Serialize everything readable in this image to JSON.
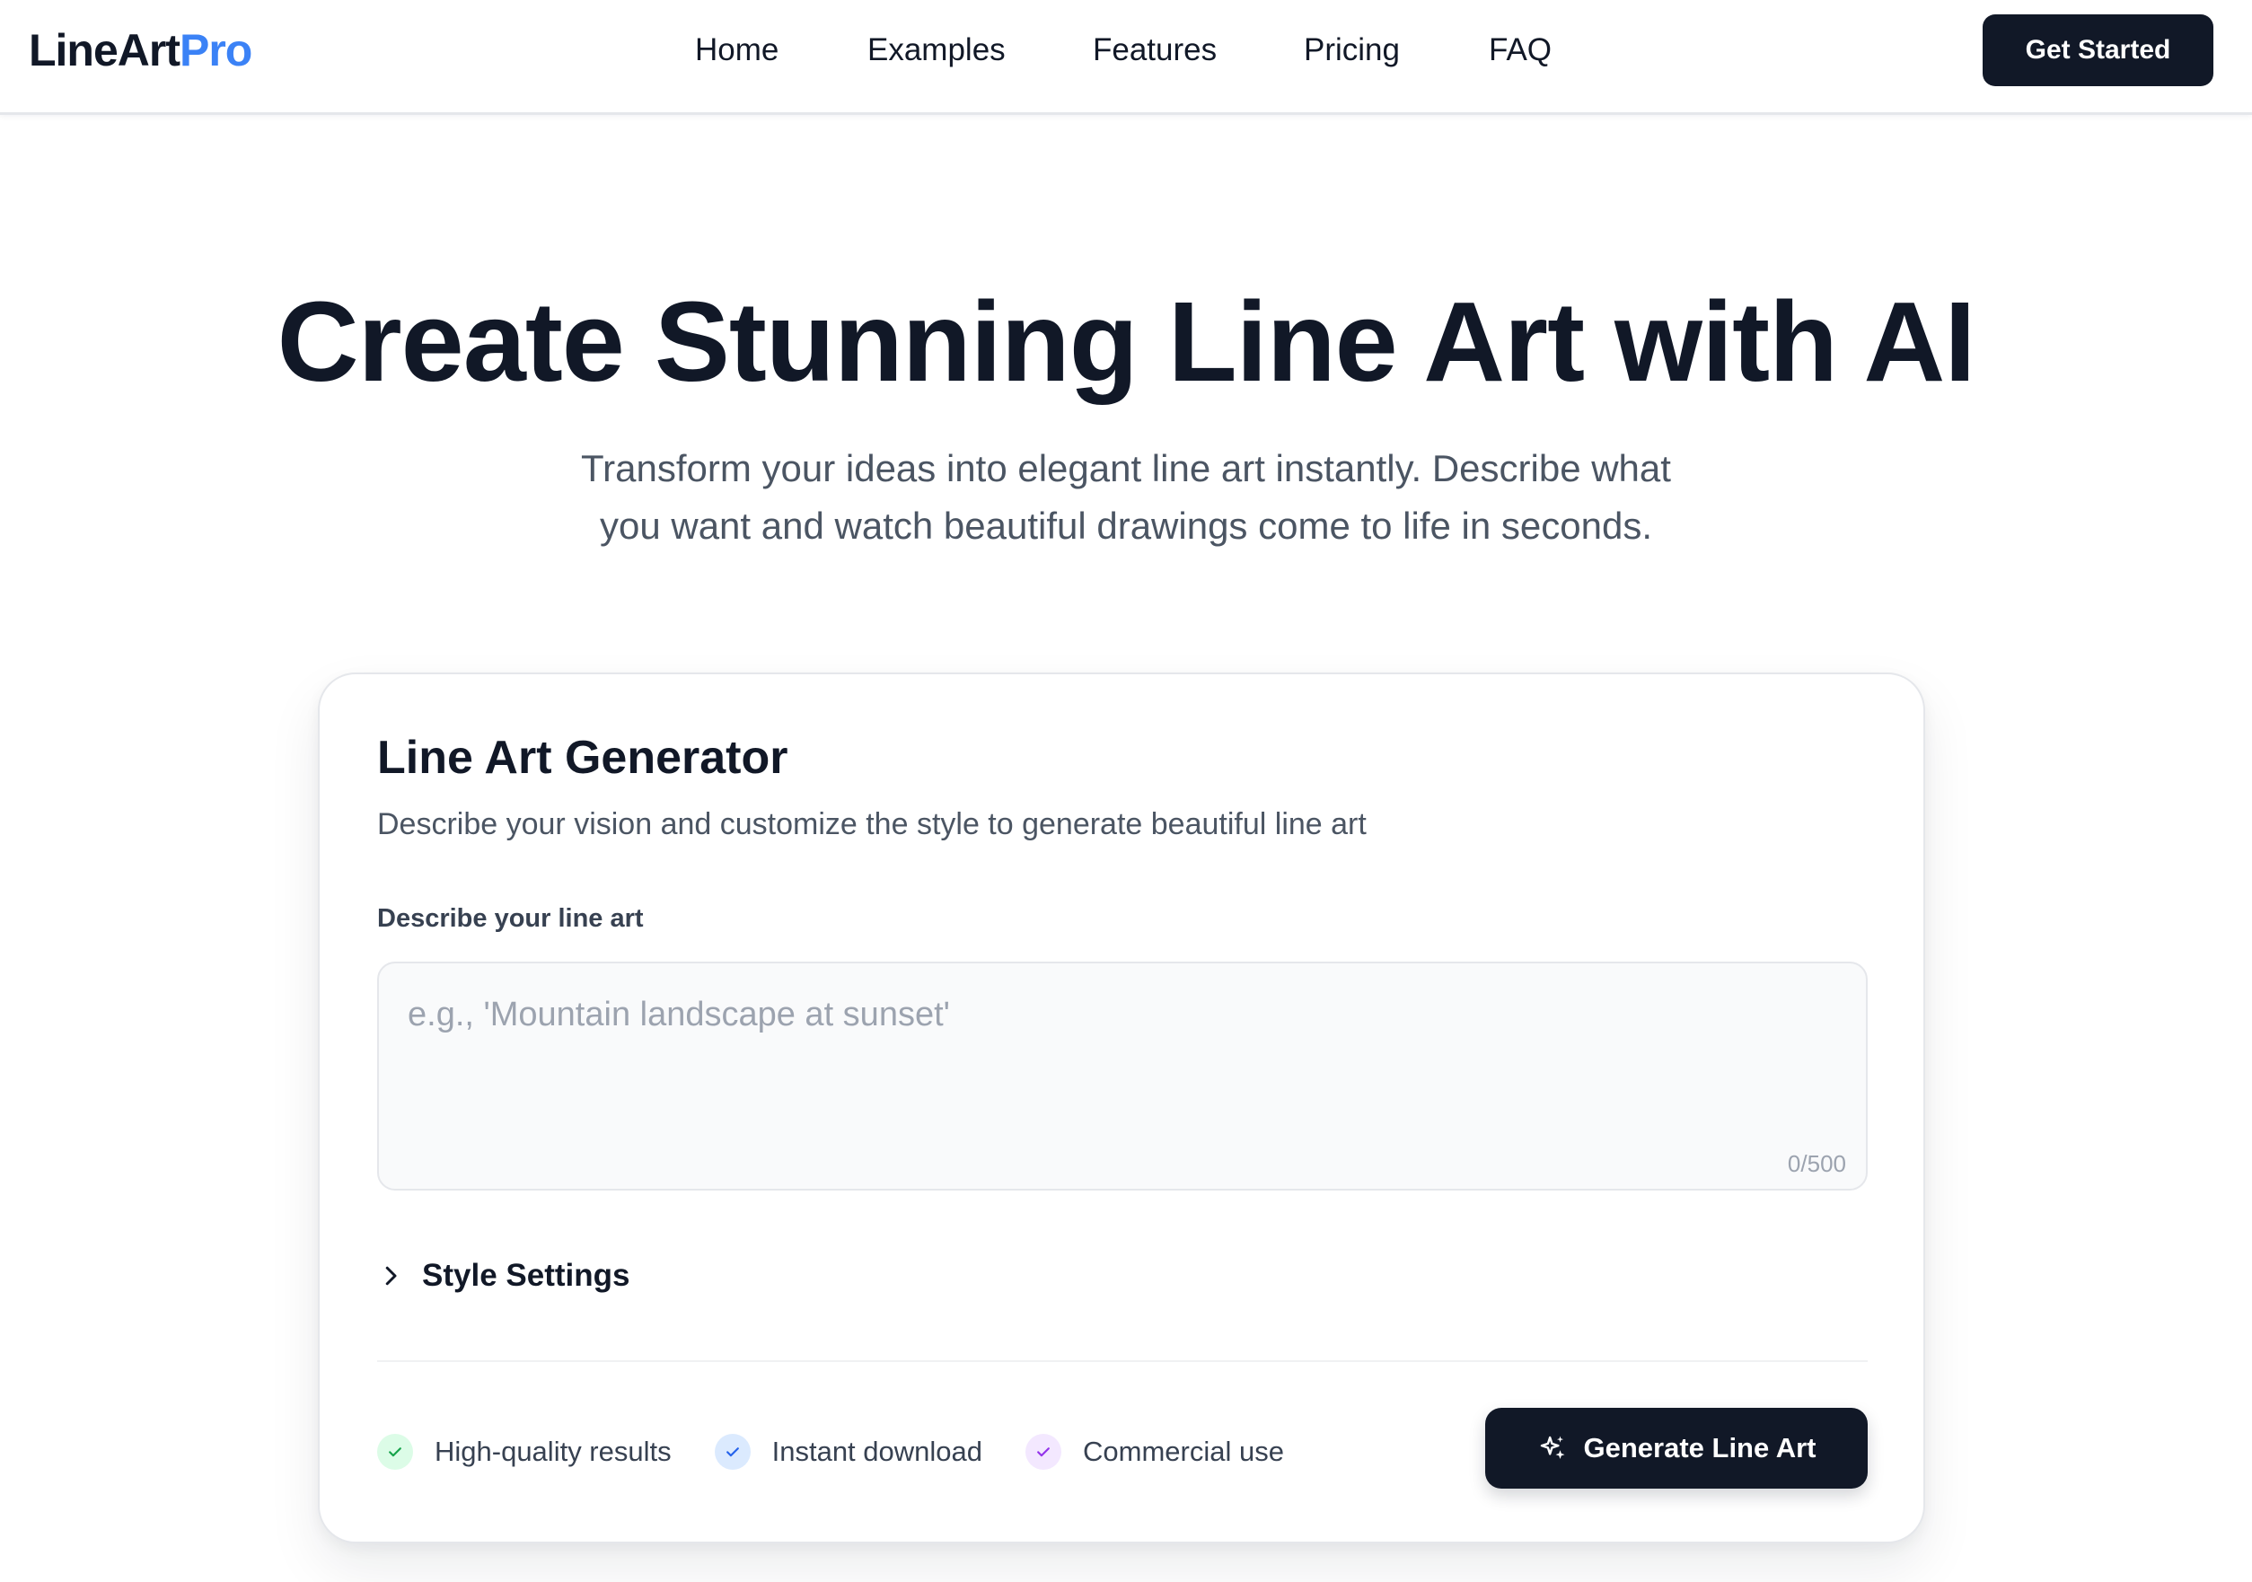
{
  "header": {
    "logo_main": "LineArt",
    "logo_accent": "Pro",
    "nav": [
      "Home",
      "Examples",
      "Features",
      "Pricing",
      "FAQ"
    ],
    "cta_label": "Get Started"
  },
  "hero": {
    "title": "Create Stunning Line Art with AI",
    "subtitle_line1": "Transform your ideas into elegant line art instantly. Describe what",
    "subtitle_line2": "you want and watch beautiful drawings come to life in seconds."
  },
  "generator": {
    "title": "Line Art Generator",
    "subtitle": "Describe your vision and customize the style to generate beautiful line art",
    "field_label": "Describe your line art",
    "prompt_value": "",
    "prompt_placeholder": "e.g., 'Mountain landscape at sunset'",
    "char_count": "0/500",
    "style_settings_label": "Style Settings",
    "features": [
      {
        "label": "High-quality results",
        "icon": "check-icon",
        "bg": "#dcfce7",
        "color": "#16a34a"
      },
      {
        "label": "Instant download",
        "icon": "check-icon",
        "bg": "#dbeafe",
        "color": "#2563eb"
      },
      {
        "label": "Commercial use",
        "icon": "check-icon",
        "bg": "#f3e8ff",
        "color": "#9333ea"
      }
    ],
    "generate_label": "Generate Line Art",
    "generate_icon": "sparkles-icon"
  },
  "colors": {
    "brand_dark": "#111827",
    "accent_blue": "#3b82f6"
  }
}
